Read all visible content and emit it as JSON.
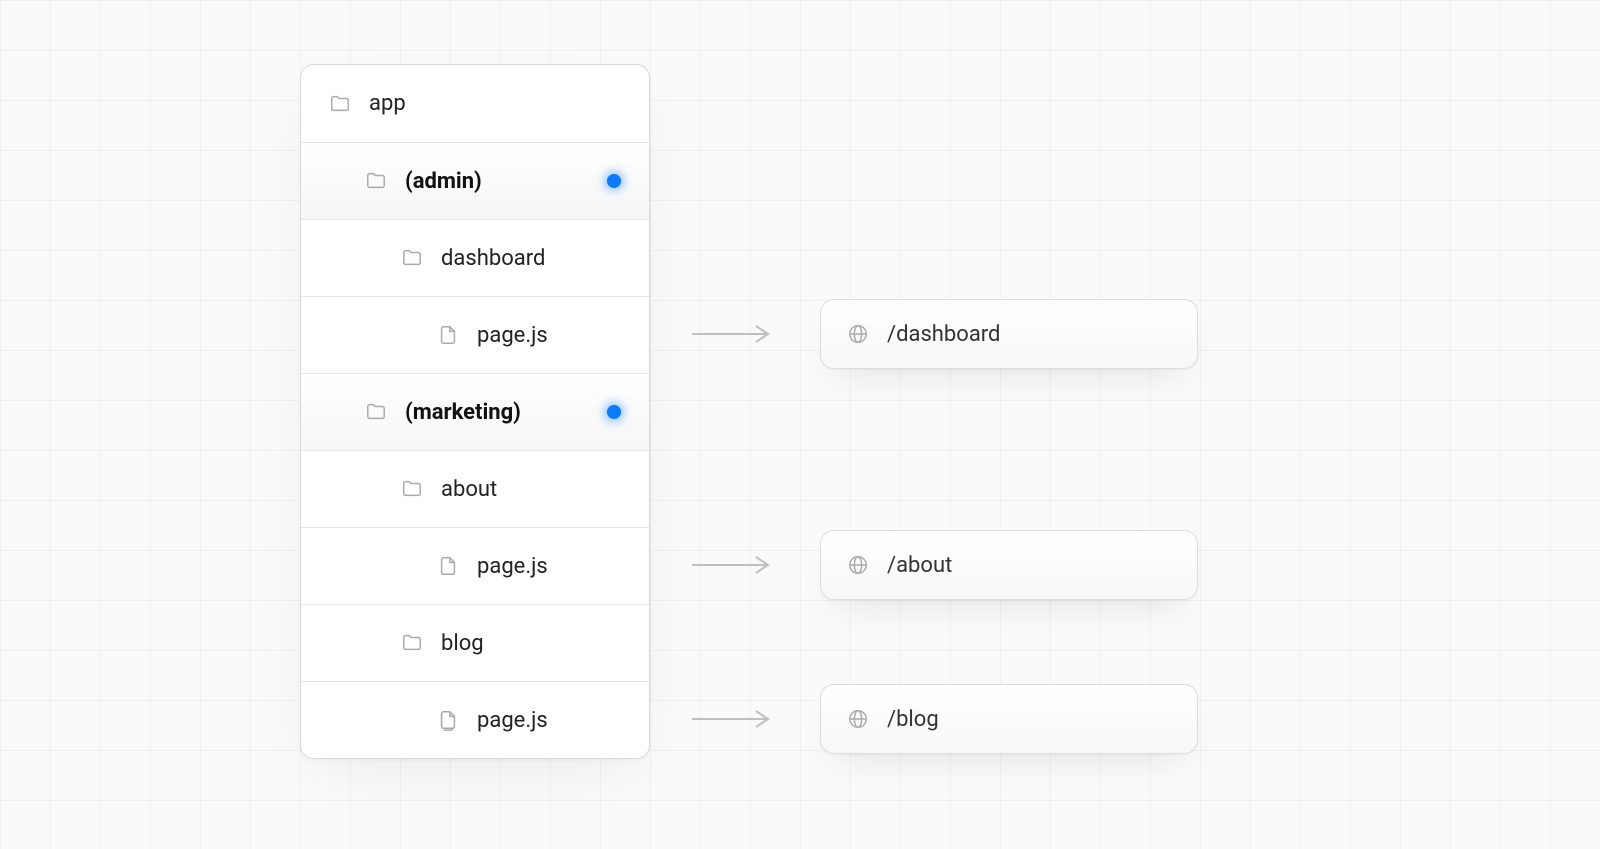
{
  "tree": {
    "root": {
      "label": "app"
    },
    "group1": {
      "label": "(admin)"
    },
    "g1f1": {
      "label": "dashboard"
    },
    "g1p1": {
      "label": "page.js"
    },
    "group2": {
      "label": "(marketing)"
    },
    "g2f1": {
      "label": "about"
    },
    "g2p1": {
      "label": "page.js"
    },
    "g2f2": {
      "label": "blog"
    },
    "g2p2": {
      "label": "page.js"
    }
  },
  "routes": {
    "dashboard": "/dashboard",
    "about": "/about",
    "blog": "/blog"
  }
}
